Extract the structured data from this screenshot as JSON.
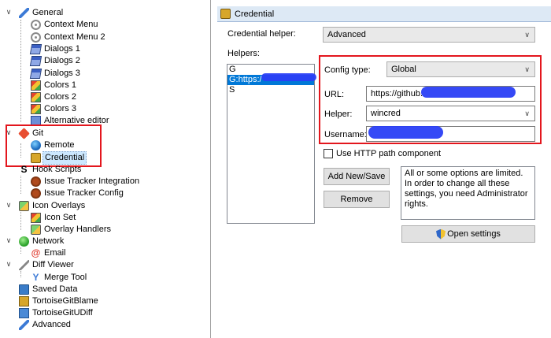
{
  "tree": {
    "items": [
      {
        "label": "General",
        "icon": "wrench-icon"
      },
      {
        "label": "Context Menu",
        "icon": "gear-icon"
      },
      {
        "label": "Context Menu 2",
        "icon": "gear-icon"
      },
      {
        "label": "Dialogs 1",
        "icon": "dialog-icon"
      },
      {
        "label": "Dialogs 2",
        "icon": "dialog-icon"
      },
      {
        "label": "Dialogs 3",
        "icon": "dialog-icon"
      },
      {
        "label": "Colors 1",
        "icon": "colors-icon"
      },
      {
        "label": "Colors 2",
        "icon": "colors-icon"
      },
      {
        "label": "Colors 3",
        "icon": "colors-icon"
      },
      {
        "label": "Alternative editor",
        "icon": "editor-icon"
      },
      {
        "label": "Git",
        "icon": "git-icon"
      },
      {
        "label": "Remote",
        "icon": "globe-icon"
      },
      {
        "label": "Credential",
        "icon": "credential-icon"
      },
      {
        "label": "Hook Scripts",
        "icon": "hook-icon"
      },
      {
        "label": "Issue Tracker Integration",
        "icon": "bug-icon"
      },
      {
        "label": "Issue Tracker Config",
        "icon": "bug-icon"
      },
      {
        "label": "Icon Overlays",
        "icon": "overlay-icon"
      },
      {
        "label": "Icon Set",
        "icon": "colors-icon"
      },
      {
        "label": "Overlay Handlers",
        "icon": "overlay-icon"
      },
      {
        "label": "Network",
        "icon": "network-icon"
      },
      {
        "label": "Email",
        "icon": "email-icon"
      },
      {
        "label": "Diff Viewer",
        "icon": "diff-icon"
      },
      {
        "label": "Merge Tool",
        "icon": "merge-icon"
      },
      {
        "label": "Saved Data",
        "icon": "saved-data-icon"
      },
      {
        "label": "TortoiseGitBlame",
        "icon": "blame-icon"
      },
      {
        "label": "TortoiseGitUDiff",
        "icon": "udiff-icon"
      },
      {
        "label": "Advanced",
        "icon": "wrench-icon"
      }
    ]
  },
  "panel": {
    "title": "Credential",
    "credential_helper_label": "Credential helper:",
    "credential_helper_value": "Advanced",
    "helpers_label": "Helpers:",
    "helpers": [
      "G",
      "G:https:/",
      "S"
    ],
    "config_type_label": "Config type:",
    "config_type_value": "Global",
    "url_label": "URL:",
    "url_value": "https://github.",
    "helper_label": "Helper:",
    "helper_value": "wincred",
    "username_label": "Username:",
    "username_value": "",
    "use_http_path_label": "Use HTTP path component",
    "add_new_save_label": "Add New/Save",
    "remove_label": "Remove",
    "info_text": "All or some options are limited. In order to change all these settings, you need Administrator rights.",
    "open_settings_label": "Open settings"
  },
  "colors": {
    "highlight_box": "#e3161d",
    "redaction": "#2a3ff5",
    "selection": "#0078d7"
  }
}
